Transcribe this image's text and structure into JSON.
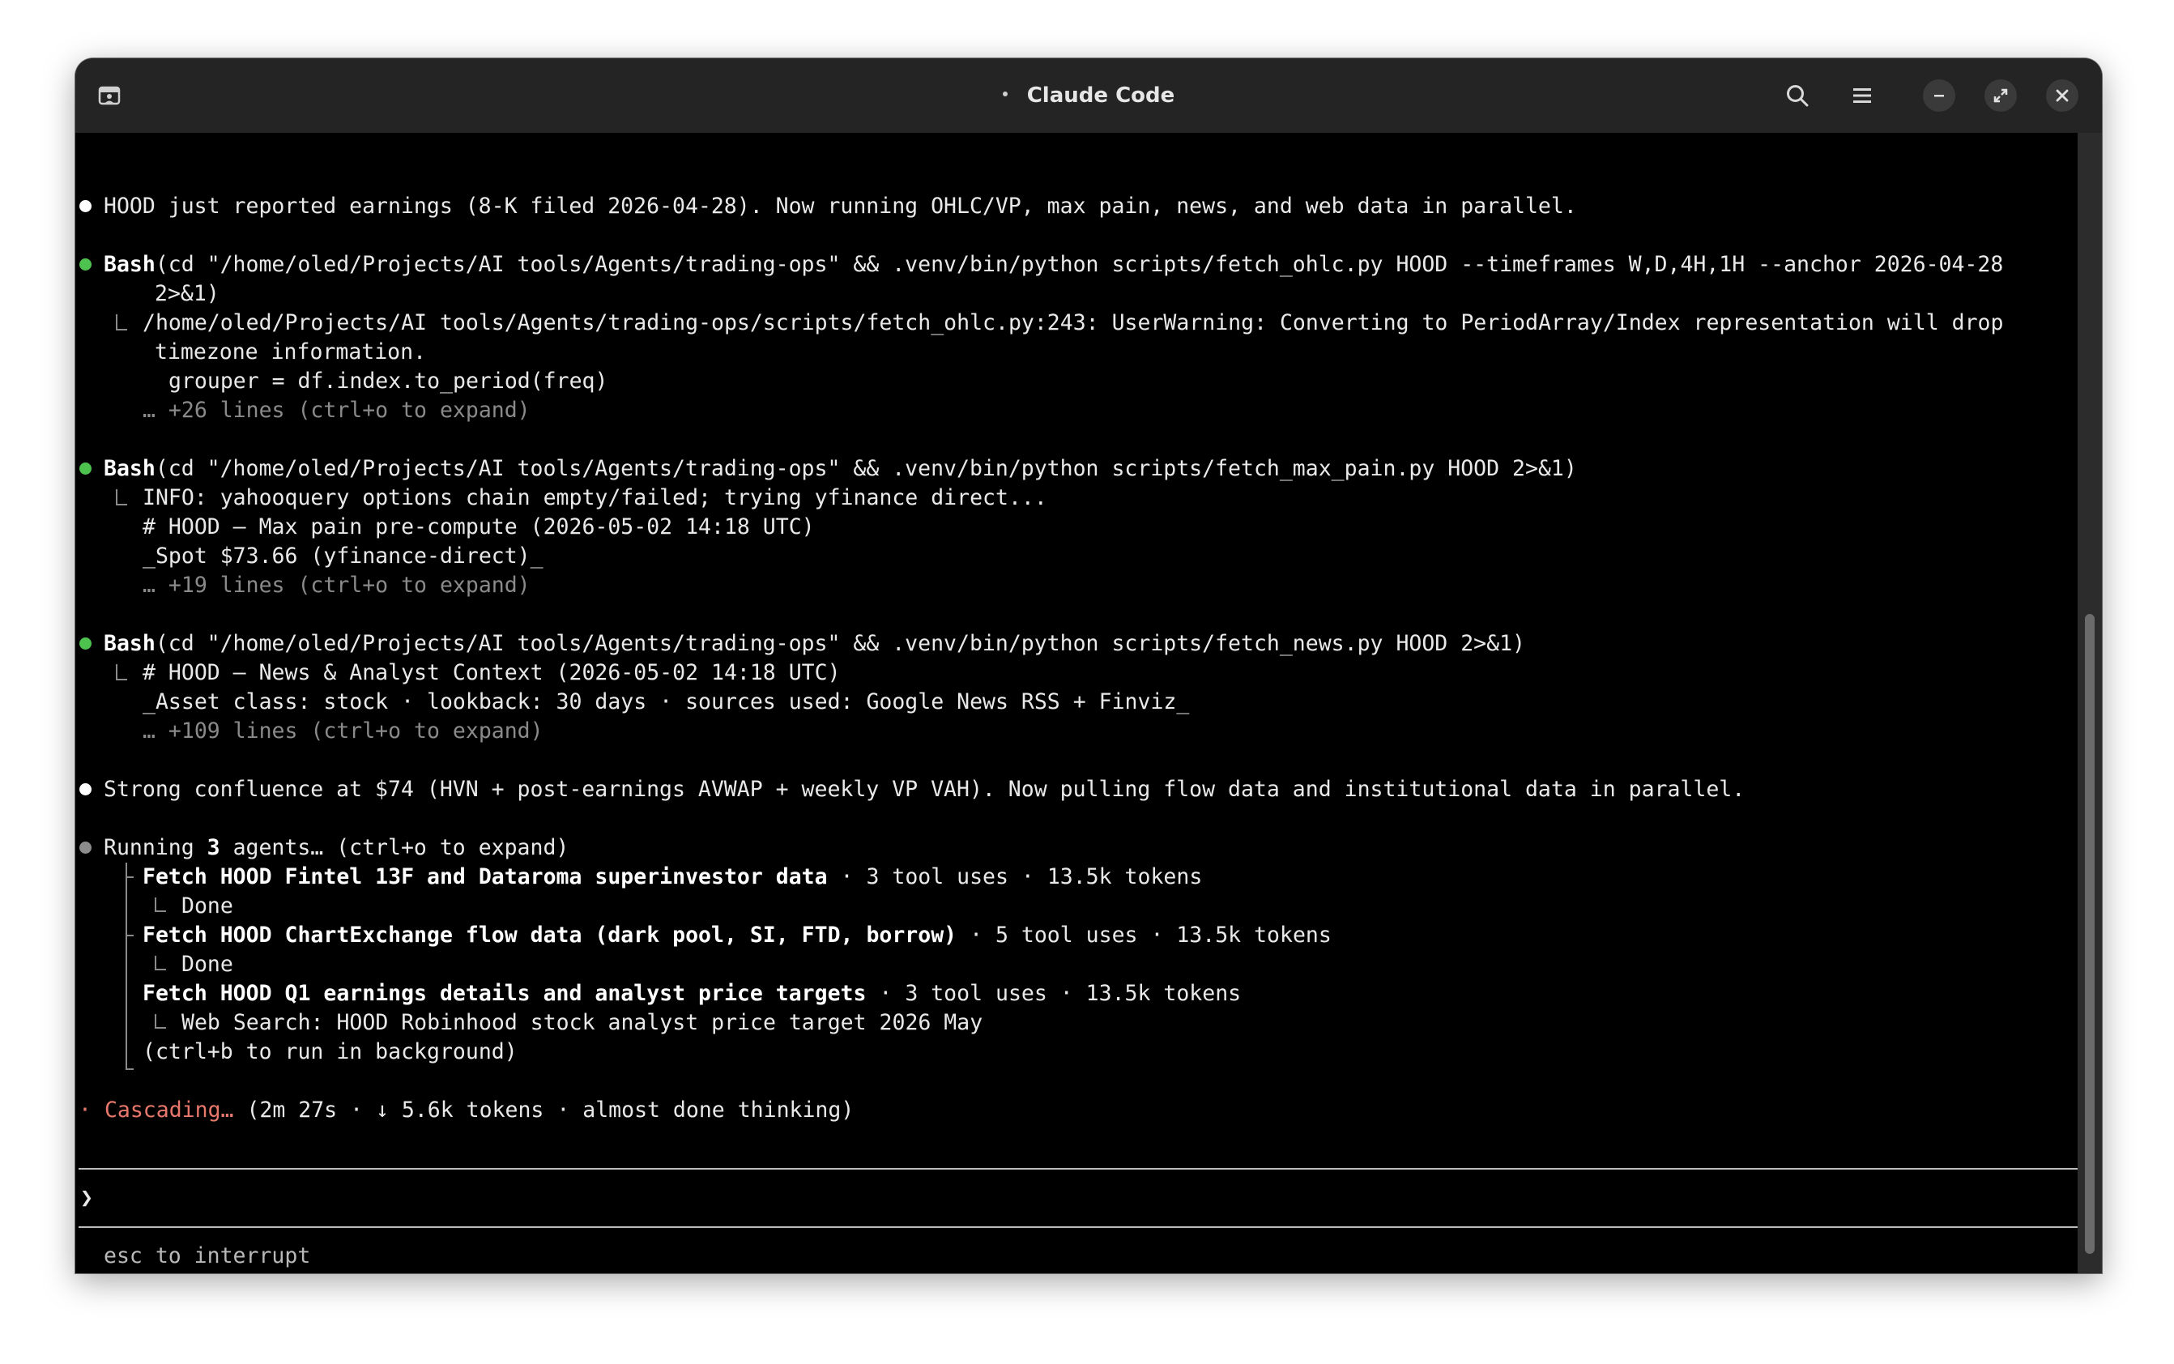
{
  "window": {
    "title": "Claude Code",
    "left_icon": "terminal-tab-icon"
  },
  "titlebar_buttons": {
    "search": "search-icon",
    "menu": "hamburger-menu-icon",
    "minimize": "minimize-icon",
    "maximize": "maximize-icon",
    "close": "close-icon"
  },
  "colors": {
    "terminal_bg": "#000000",
    "titlebar_bg": "#242424",
    "bullet_green": "#4ec24e",
    "bullet_white": "#ffffff",
    "accent_orange": "#e8776c",
    "dim_text": "#8a8a8a"
  },
  "transcript": {
    "msg1": "HOOD just reported earnings (8-K filed 2026-04-28). Now running OHLC/VP, max pain, news, and web data in parallel.",
    "tool1": {
      "name": "Bash",
      "cmd_line1": "(cd \"/home/oled/Projects/AI tools/Agents/trading-ops\" && .venv/bin/python scripts/fetch_ohlc.py HOOD --timeframes W,D,4H,1H --anchor 2026-04-28",
      "cmd_line2": "2>&1)",
      "out1": "/home/oled/Projects/AI tools/Agents/trading-ops/scripts/fetch_ohlc.py:243: UserWarning: Converting to PeriodArray/Index representation will drop",
      "out2": "timezone information.",
      "out3": "grouper = df.index.to_period(freq)",
      "more": "… +26 lines (ctrl+o to expand)"
    },
    "tool2": {
      "name": "Bash",
      "cmd": "(cd \"/home/oled/Projects/AI tools/Agents/trading-ops\" && .venv/bin/python scripts/fetch_max_pain.py HOOD 2>&1)",
      "out1": "INFO: yahooquery options chain empty/failed; trying yfinance direct...",
      "out2": "# HOOD — Max pain pre-compute (2026-05-02 14:18 UTC)",
      "out3": "_Spot $73.66 (yfinance-direct)_",
      "more": "… +19 lines (ctrl+o to expand)"
    },
    "tool3": {
      "name": "Bash",
      "cmd": "(cd \"/home/oled/Projects/AI tools/Agents/trading-ops\" && .venv/bin/python scripts/fetch_news.py HOOD 2>&1)",
      "out1": "# HOOD — News & Analyst Context (2026-05-02 14:18 UTC)",
      "out2": "_Asset class: stock · lookback: 30 days · sources used: Google News RSS + Finviz_",
      "more": "… +109 lines (ctrl+o to expand)"
    },
    "msg2": "Strong confluence at $74 (HVN + post-earnings AVWAP + weekly VP VAH). Now pulling flow data and institutional data in parallel.",
    "agents": {
      "prefix": "Running ",
      "count": "3",
      "suffix": " agents… (ctrl+o to expand)",
      "items": [
        {
          "title": "Fetch HOOD Fintel 13F and Dataroma superinvestor data",
          "stats": " · 3 tool uses · 13.5k tokens",
          "status": "Done"
        },
        {
          "title": "Fetch HOOD ChartExchange flow data (dark pool, SI, FTD, borrow)",
          "stats": " · 5 tool uses · 13.5k tokens",
          "status": "Done"
        },
        {
          "title": "Fetch HOOD Q1 earnings details and analyst price targets",
          "stats": " · 3 tool uses · 13.5k tokens",
          "status": "Web Search: HOOD Robinhood stock analyst price target 2026 May"
        }
      ],
      "background_hint": "(ctrl+b to run in background)"
    },
    "spinner": {
      "glyph": "·",
      "label": "Cascading…",
      "detail": " (2m 27s · ↓ 5.6k tokens · almost done thinking)"
    }
  },
  "prompt": {
    "symbol": "❯",
    "value": ""
  },
  "footer": {
    "hint": "esc to interrupt"
  }
}
